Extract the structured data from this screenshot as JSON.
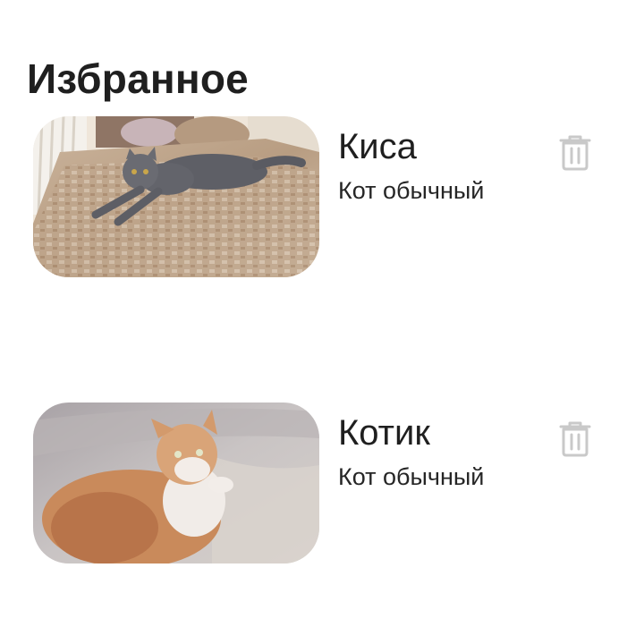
{
  "page": {
    "title": "Избранное"
  },
  "favorites": [
    {
      "name": "Киса",
      "breed": "Кот обычный",
      "photo_icon": "gray-cat-on-bed-photo",
      "delete_icon": "trash-icon"
    },
    {
      "name": "Котик",
      "breed": "Кот обычный",
      "photo_icon": "ginger-white-cat-photo",
      "delete_icon": "trash-icon"
    }
  ],
  "colors": {
    "text_primary": "#1f1f1f",
    "icon_muted": "#c9c9c9",
    "background": "#ffffff"
  }
}
